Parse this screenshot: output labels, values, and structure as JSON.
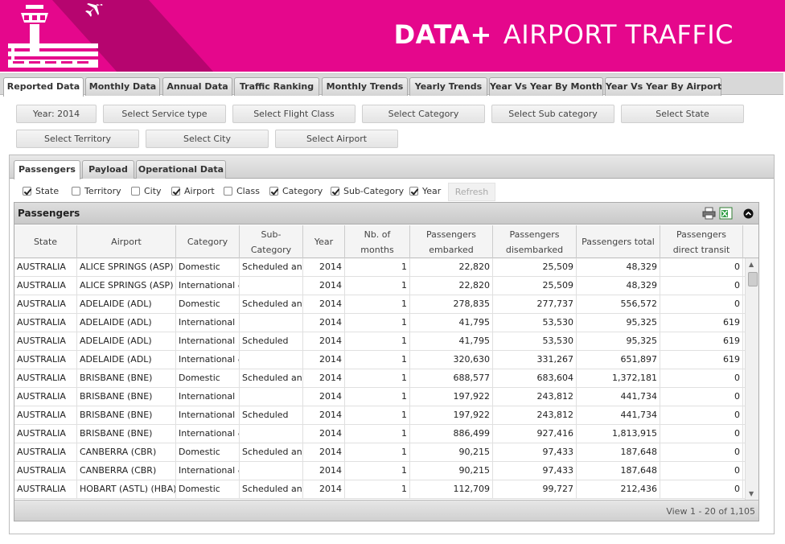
{
  "header": {
    "brand": "DATA+",
    "title": "AIRPORT TRAFFIC",
    "color_bg": "#e5078c"
  },
  "top_tabs": [
    {
      "label": "Reported Data",
      "active": true
    },
    {
      "label": "Monthly Data"
    },
    {
      "label": "Annual Data"
    },
    {
      "label": "Traffic Ranking"
    },
    {
      "label": "Monthly Trends"
    },
    {
      "label": "Yearly Trends"
    },
    {
      "label": "Year Vs Year By Month"
    },
    {
      "label": "Year Vs Year By Airport"
    }
  ],
  "filters": [
    {
      "label": "Year: 2014"
    },
    {
      "label": "Select Service type"
    },
    {
      "label": "Select Flight Class"
    },
    {
      "label": "Select Category"
    },
    {
      "label": "Select Sub category"
    },
    {
      "label": "Select State"
    },
    {
      "label": "Select Territory"
    },
    {
      "label": "Select City"
    },
    {
      "label": "Select Airport"
    }
  ],
  "sub_tabs": [
    {
      "label": "Passengers",
      "active": true
    },
    {
      "label": "Payload"
    },
    {
      "label": "Operational Data"
    }
  ],
  "columns_toggle": [
    {
      "label": "State",
      "checked": true
    },
    {
      "label": "Territory",
      "checked": false
    },
    {
      "label": "City",
      "checked": false
    },
    {
      "label": "Airport",
      "checked": true
    },
    {
      "label": "Class",
      "checked": false
    },
    {
      "label": "Category",
      "checked": true
    },
    {
      "label": "Sub-Category",
      "checked": true
    },
    {
      "label": "Year",
      "checked": true
    }
  ],
  "refresh_label": "Refresh",
  "grid": {
    "title": "Passengers",
    "icons": [
      "print-icon",
      "excel-export-icon",
      "collapse-icon"
    ],
    "headers": [
      "State",
      "Airport",
      "Category",
      "Sub-Category",
      "Year",
      "Nb. of months",
      "Passengers embarked",
      "Passengers disembarked",
      "Passengers total",
      "Passengers direct transit"
    ],
    "rows": [
      [
        "AUSTRALIA",
        "ALICE SPRINGS (ASP)",
        "Domestic",
        "Scheduled and n",
        "2014",
        "1",
        "22,820",
        "25,509",
        "48,329",
        "0"
      ],
      [
        "AUSTRALIA",
        "ALICE SPRINGS (ASP)",
        "International &",
        "",
        "2014",
        "1",
        "22,820",
        "25,509",
        "48,329",
        "0"
      ],
      [
        "AUSTRALIA",
        "ADELAIDE (ADL)",
        "Domestic",
        "Scheduled and n",
        "2014",
        "1",
        "278,835",
        "277,737",
        "556,572",
        "0"
      ],
      [
        "AUSTRALIA",
        "ADELAIDE (ADL)",
        "International",
        "",
        "2014",
        "1",
        "41,795",
        "53,530",
        "95,325",
        "619"
      ],
      [
        "AUSTRALIA",
        "ADELAIDE (ADL)",
        "International",
        "Scheduled",
        "2014",
        "1",
        "41,795",
        "53,530",
        "95,325",
        "619"
      ],
      [
        "AUSTRALIA",
        "ADELAIDE (ADL)",
        "International &",
        "",
        "2014",
        "1",
        "320,630",
        "331,267",
        "651,897",
        "619"
      ],
      [
        "AUSTRALIA",
        "BRISBANE (BNE)",
        "Domestic",
        "Scheduled and n",
        "2014",
        "1",
        "688,577",
        "683,604",
        "1,372,181",
        "0"
      ],
      [
        "AUSTRALIA",
        "BRISBANE (BNE)",
        "International",
        "",
        "2014",
        "1",
        "197,922",
        "243,812",
        "441,734",
        "0"
      ],
      [
        "AUSTRALIA",
        "BRISBANE (BNE)",
        "International",
        "Scheduled",
        "2014",
        "1",
        "197,922",
        "243,812",
        "441,734",
        "0"
      ],
      [
        "AUSTRALIA",
        "BRISBANE (BNE)",
        "International &",
        "",
        "2014",
        "1",
        "886,499",
        "927,416",
        "1,813,915",
        "0"
      ],
      [
        "AUSTRALIA",
        "CANBERRA (CBR)",
        "Domestic",
        "Scheduled and n",
        "2014",
        "1",
        "90,215",
        "97,433",
        "187,648",
        "0"
      ],
      [
        "AUSTRALIA",
        "CANBERRA (CBR)",
        "International &",
        "",
        "2014",
        "1",
        "90,215",
        "97,433",
        "187,648",
        "0"
      ],
      [
        "AUSTRALIA",
        "HOBART (ASTL) (HBA)",
        "Domestic",
        "Scheduled and n",
        "2014",
        "1",
        "112,709",
        "99,727",
        "212,436",
        "0"
      ]
    ],
    "pager": "View 1 - 20 of 1,105"
  }
}
